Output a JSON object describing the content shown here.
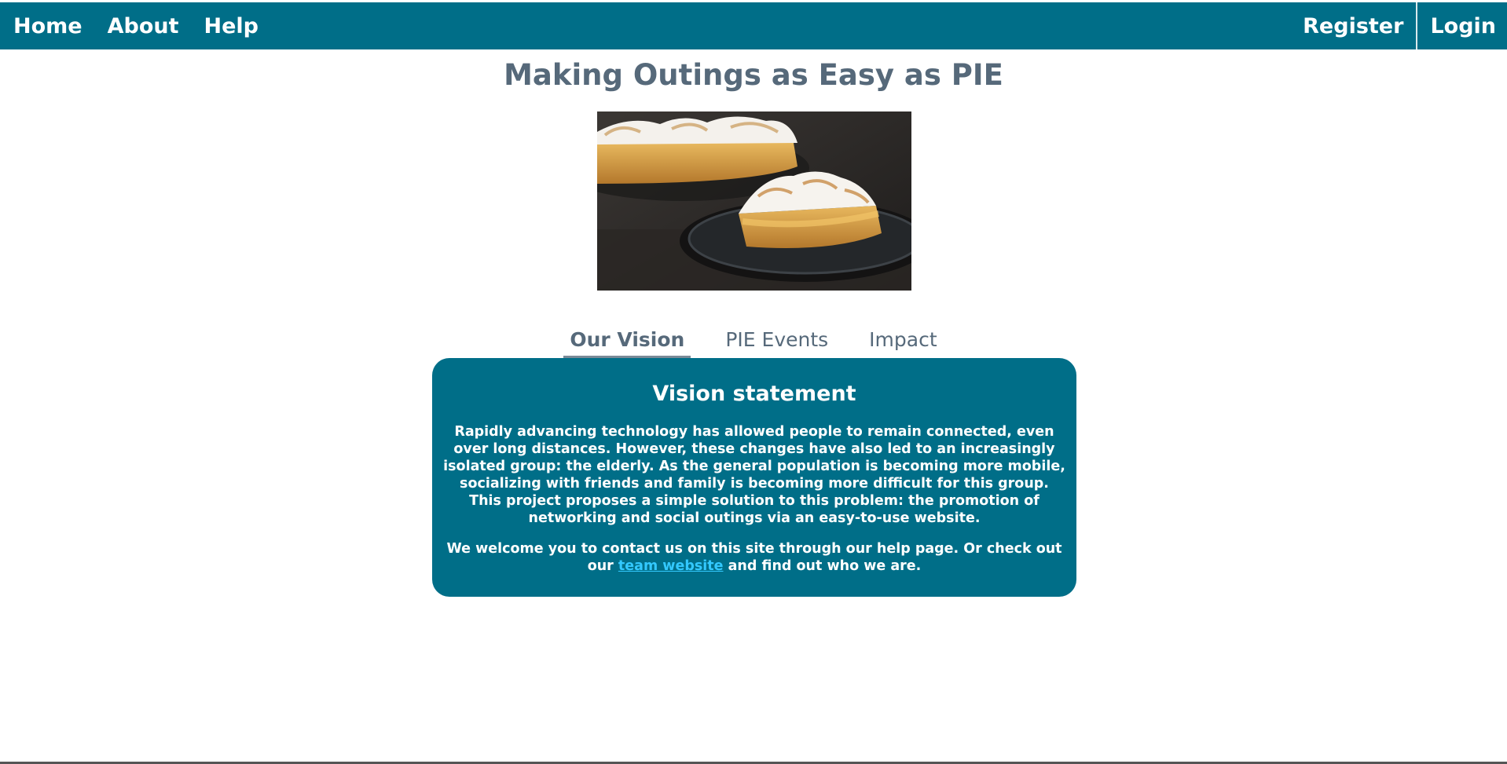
{
  "nav": {
    "home": "Home",
    "about": "About",
    "help": "Help",
    "register": "Register",
    "login": "Login"
  },
  "title": "Making Outings as Easy as PIE",
  "tabs": [
    "Our Vision",
    "PIE Events",
    "Impact"
  ],
  "panel": {
    "heading": "Vision statement",
    "para1": "Rapidly advancing technology has allowed people to remain connected, even over long distances. However, these changes have also led to an increasingly isolated group: the elderly. As the general population is becoming more mobile, socializing with friends and family is becoming more difficult for this group. This project proposes a simple solution to this problem: the promotion of networking and social outings via an easy-to-use website.",
    "para2_before": "We welcome you to contact us on this site through our help page. Or check out our ",
    "link_text": "team website",
    "para2_after": " and find out who we are."
  },
  "colors": {
    "primary": "#006e88",
    "title": "#56697a",
    "link": "#33c9ff"
  }
}
